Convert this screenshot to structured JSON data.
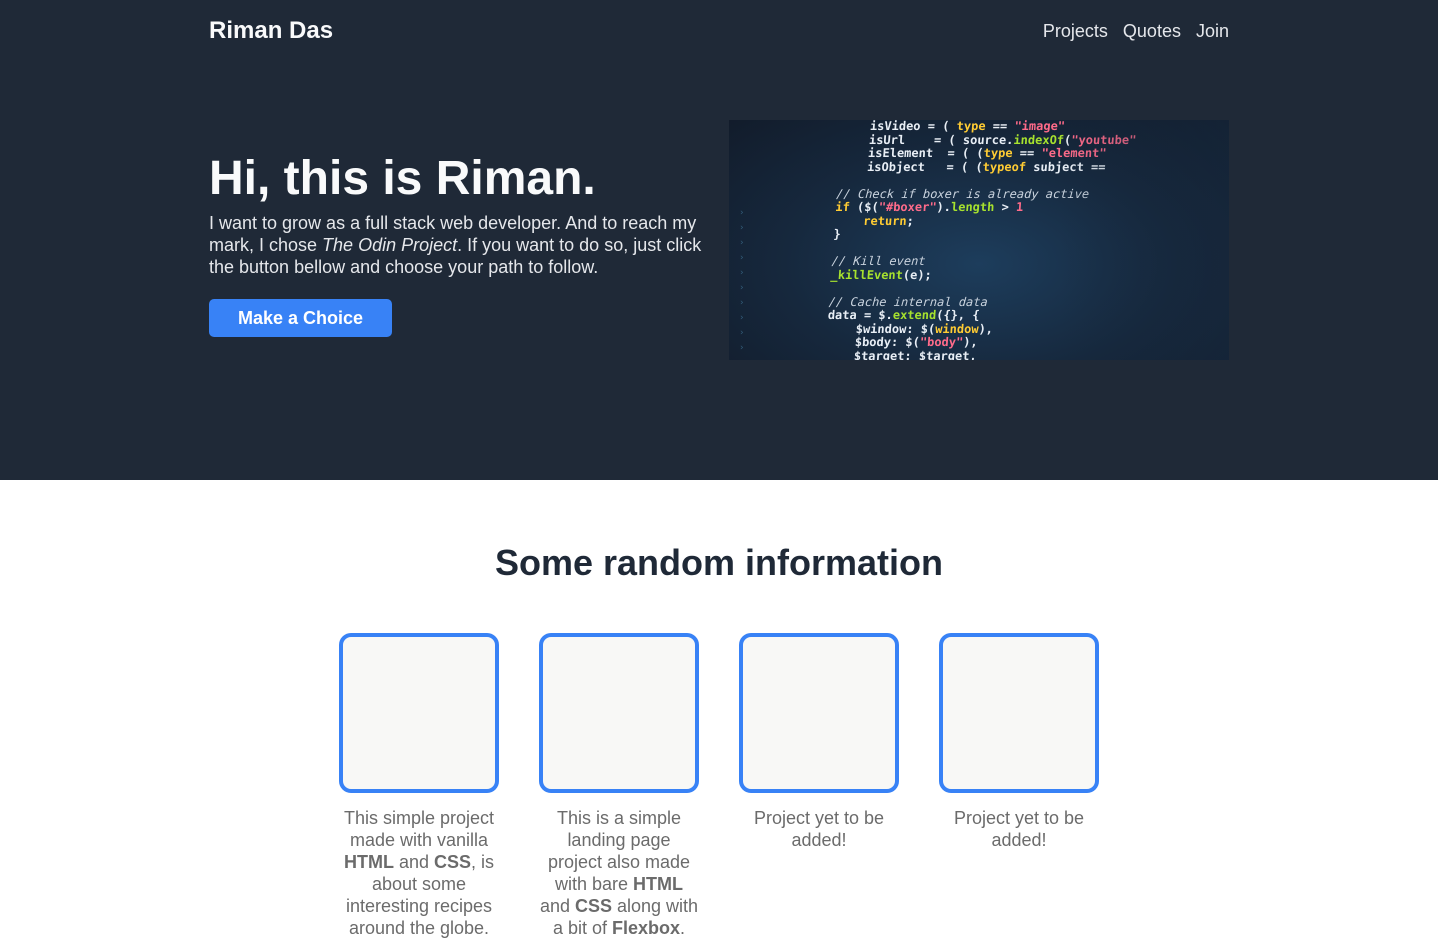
{
  "nav": {
    "brand": "Riman Das",
    "links": [
      "Projects",
      "Quotes",
      "Join"
    ]
  },
  "hero": {
    "heading": "Hi, this is Riman.",
    "text_before": "I want to grow as a full stack web developer. And to reach my mark, I chose ",
    "text_em": "The Odin Project",
    "text_after": ". If you want to do so, just click the button bellow and choose your path to follow.",
    "button": "Make a Choice",
    "image_icon": "code-screenshot-image"
  },
  "section": {
    "title": "Some random information",
    "cards": [
      {
        "parts": [
          "This simple project made with vanilla ",
          "HTML",
          " and ",
          "CSS",
          ", is about some interesting recipes around the globe."
        ]
      },
      {
        "parts": [
          "This is a simple landing page project also made with bare ",
          "HTML",
          " and ",
          "CSS",
          " along with a bit of ",
          "Flexbox",
          "."
        ]
      },
      {
        "parts": [
          "Project yet to be added!"
        ]
      },
      {
        "parts": [
          "Project yet to be added!"
        ]
      }
    ]
  },
  "colors": {
    "hero_bg": "#1f2937",
    "accent": "#3882f6",
    "card_bg": "#f8f8f6"
  }
}
